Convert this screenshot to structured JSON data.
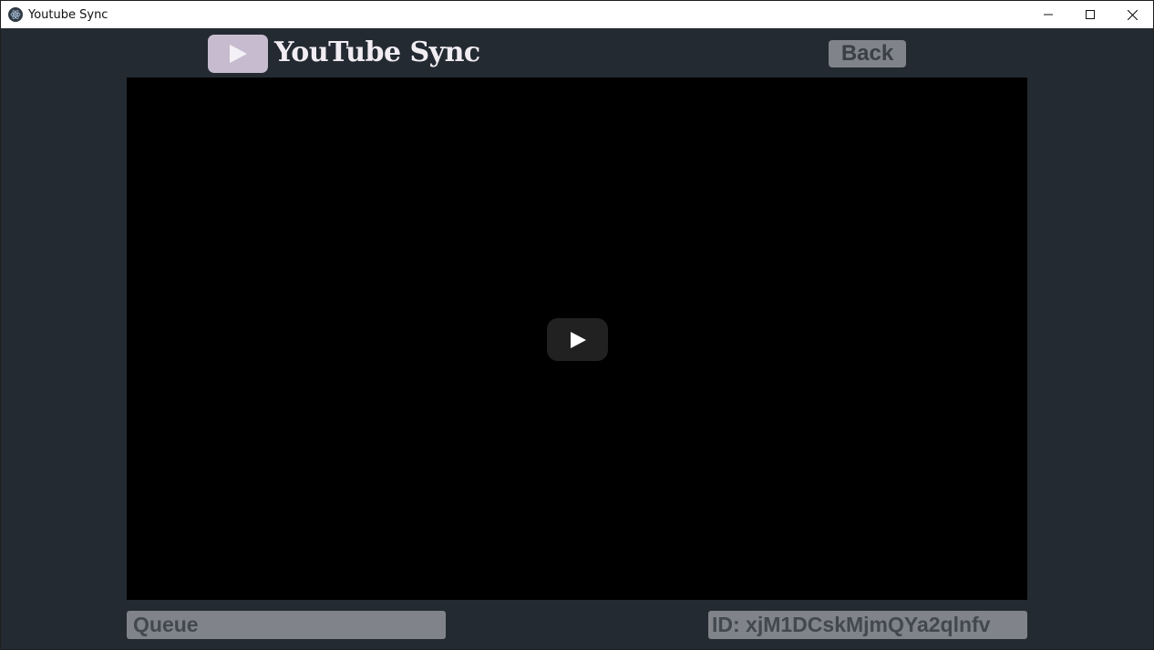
{
  "window": {
    "title": "Youtube Sync",
    "icon": "electron-atom-icon",
    "controls": [
      "minimize-icon",
      "maximize-icon",
      "close-icon"
    ]
  },
  "header": {
    "logo_icon": "play-triangle-icon",
    "logo_text": "YouTube Sync",
    "back_label": "Back"
  },
  "player": {
    "play_icon": "youtube-play-icon"
  },
  "footer": {
    "queue_label": "Queue",
    "id_label": "ID: xjM1DCskMjmQYa2qlnfv"
  },
  "colors": {
    "background": "#242a31",
    "button_gray": "#808389",
    "logo_lavender": "#c7bccf",
    "player_black": "#000000"
  }
}
